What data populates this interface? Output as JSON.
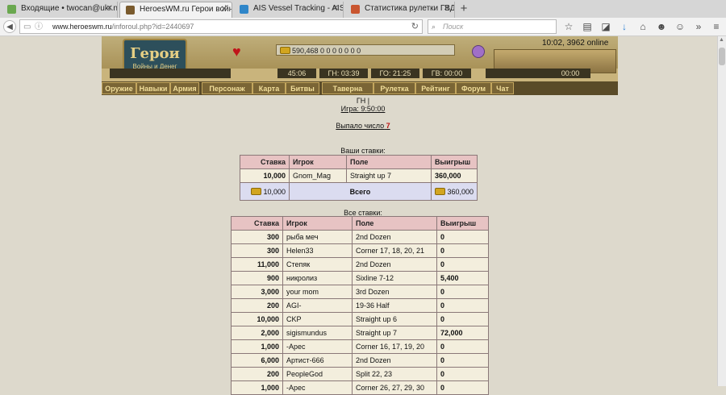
{
  "browser": {
    "tabs": [
      {
        "label": "Входящие • twocan@ukr.n...",
        "icon_color": "#6aa84f",
        "active": false
      },
      {
        "label": "HeroesWM.ru Герои войн...",
        "icon_color": "#7a5b2e",
        "active": true
      },
      {
        "label": "AIS Vessel Tracking - AIS P...",
        "icon_color": "#2f86c9",
        "active": false
      },
      {
        "label": "Статистика рулетки ГВД - ...",
        "icon_color": "#c9552f",
        "active": false
      }
    ],
    "new_tab": "+",
    "url_host": "www.heroeswm.ru",
    "url_path": "/inforoul.php?id=2440697",
    "search_placeholder": "Поиск"
  },
  "game": {
    "logo_title": "Герои",
    "logo_sub": "Войны и Денег",
    "clock_text": "10:02, 3962 online",
    "resources": "590,468  0  0  0  0  0  0  0",
    "timers": [
      "45:06",
      "ГН: 03:39",
      "ГО: 21:25",
      "ГВ: 00:00",
      "00:00"
    ],
    "nav": [
      "Оружие",
      "Навыки",
      "Армия",
      "Персонаж",
      "Карта",
      "Битвы",
      "Таверна",
      "Рулетка",
      "Рейтинг",
      "Форум",
      "Чат"
    ]
  },
  "page": {
    "gn": "ГН |",
    "game_time": "Игра: 9:50:00",
    "dropped_label": "Выпало число",
    "dropped_number": "7",
    "your_bets_title": "Ваши ставки:",
    "all_bets_title": "Все ставки:",
    "headers": [
      "Ставка",
      "Игрок",
      "Поле",
      "Выигрыш"
    ],
    "your_bets": [
      {
        "bet": "10,000",
        "player": "Gnom_Mag",
        "field": "Straight up 7",
        "win": "360,000"
      }
    ],
    "total": {
      "bet": "10,000",
      "label": "Всего",
      "win": "360,000"
    },
    "all_bets": [
      {
        "bet": "300",
        "player": "рыба меч",
        "field": "2nd Dozen",
        "win": "0"
      },
      {
        "bet": "300",
        "player": "Helen33",
        "field": "Corner 17, 18, 20, 21",
        "win": "0"
      },
      {
        "bet": "11,000",
        "player": "Степяк",
        "field": "2nd Dozen",
        "win": "0"
      },
      {
        "bet": "900",
        "player": "никролиз",
        "field": "Sixline 7-12",
        "win": "5,400"
      },
      {
        "bet": "3,000",
        "player": "your mom",
        "field": "3rd Dozen",
        "win": "0"
      },
      {
        "bet": "200",
        "player": "AGI-",
        "field": "19-36 Half",
        "win": "0"
      },
      {
        "bet": "10,000",
        "player": "CKP",
        "field": "Straight up 6",
        "win": "0"
      },
      {
        "bet": "2,000",
        "player": "sigismundus",
        "field": "Straight up 7",
        "win": "72,000"
      },
      {
        "bet": "1,000",
        "player": "-Apec",
        "field": "Corner 16, 17, 19, 20",
        "win": "0"
      },
      {
        "bet": "6,000",
        "player": "Артист-666",
        "field": "2nd Dozen",
        "win": "0"
      },
      {
        "bet": "200",
        "player": "PeopleGod",
        "field": "Split 22, 23",
        "win": "0"
      },
      {
        "bet": "1,000",
        "player": "-Apec",
        "field": "Corner 26, 27, 29, 30",
        "win": "0"
      }
    ]
  }
}
